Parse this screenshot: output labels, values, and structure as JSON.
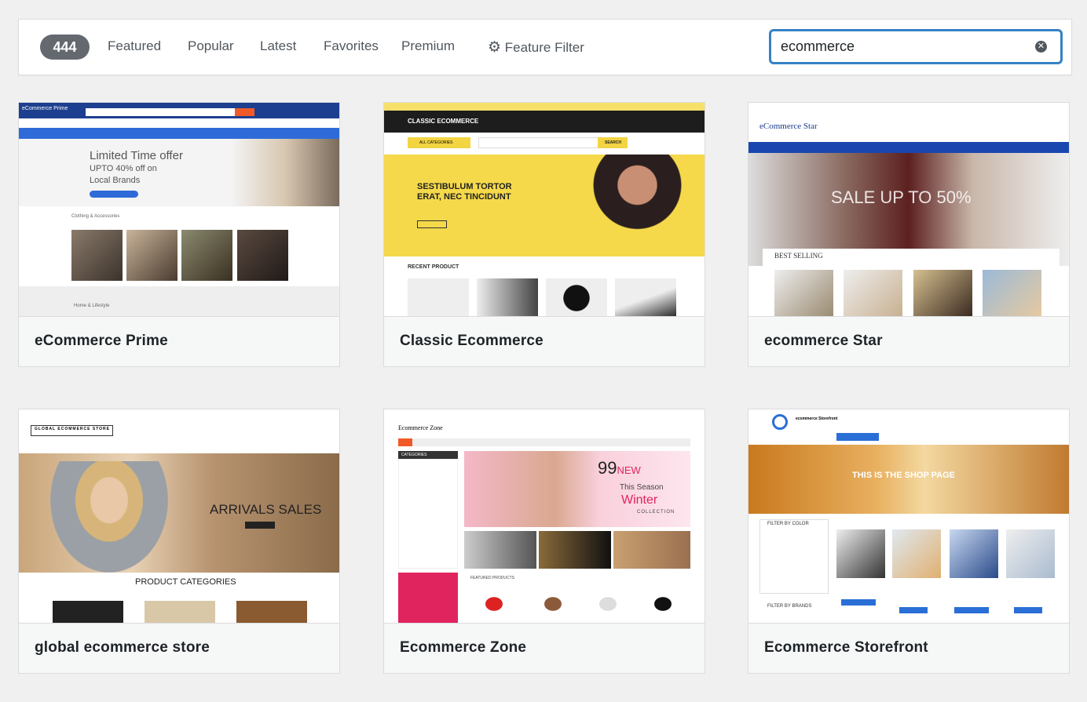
{
  "filter_bar": {
    "count": "444",
    "tabs": [
      "Featured",
      "Popular",
      "Latest",
      "Favorites",
      "Premium"
    ],
    "feature_filter": {
      "icon": "gear-icon",
      "label": "Feature Filter"
    },
    "search": {
      "value": "ecommerce",
      "clear_icon": "clear-circle-icon"
    }
  },
  "themes": [
    {
      "name": "eCommerce Prime",
      "preview": {
        "logo": "eCommerce Prime",
        "headline": "Limited Time offer",
        "sub1": "UPTO 40% off on",
        "sub2": "Local Brands",
        "section": "Clothing & Accessories",
        "section2": "Home & Lifestyle"
      }
    },
    {
      "name": "Classic Ecommerce",
      "preview": {
        "logo": "CLASSIC ECOMMERCE",
        "categories": "ALL CATEGORIES",
        "search": "SEARCH",
        "headline": "SESTIBULUM TORTOR ERAT, NEC TINCIDUNT",
        "section": "RECENT PRODUCT"
      }
    },
    {
      "name": "ecommerce Star",
      "preview": {
        "logo": "eCommerce Star",
        "headline": "SALE UP TO 50%",
        "section": "BEST SELLING"
      }
    },
    {
      "name": "global ecommerce store",
      "preview": {
        "logo": "GLOBAL ECOMMERCE STORE",
        "headline": "ARRIVALS SALES",
        "section": "PRODUCT CATEGORIES"
      }
    },
    {
      "name": "Ecommerce Zone",
      "preview": {
        "logo": "Ecommerce Zone",
        "categories": "CATEGORIES",
        "big": "99",
        "new": "NEW",
        "season": "This Season",
        "winter": "Winter",
        "collection": "COLLECTION",
        "section": "FEATURED PRODUCTS"
      }
    },
    {
      "name": "Ecommerce Storefront",
      "preview": {
        "logo": "ecommerce Storefront",
        "headline": "THIS IS THE SHOP PAGE",
        "filter1": "FILTER BY COLOR",
        "filter2": "FILTER BY BRANDS"
      }
    }
  ],
  "colors": {
    "accent": "#3582c4",
    "badge": "#646970",
    "page_bg": "#f0f0f1"
  }
}
